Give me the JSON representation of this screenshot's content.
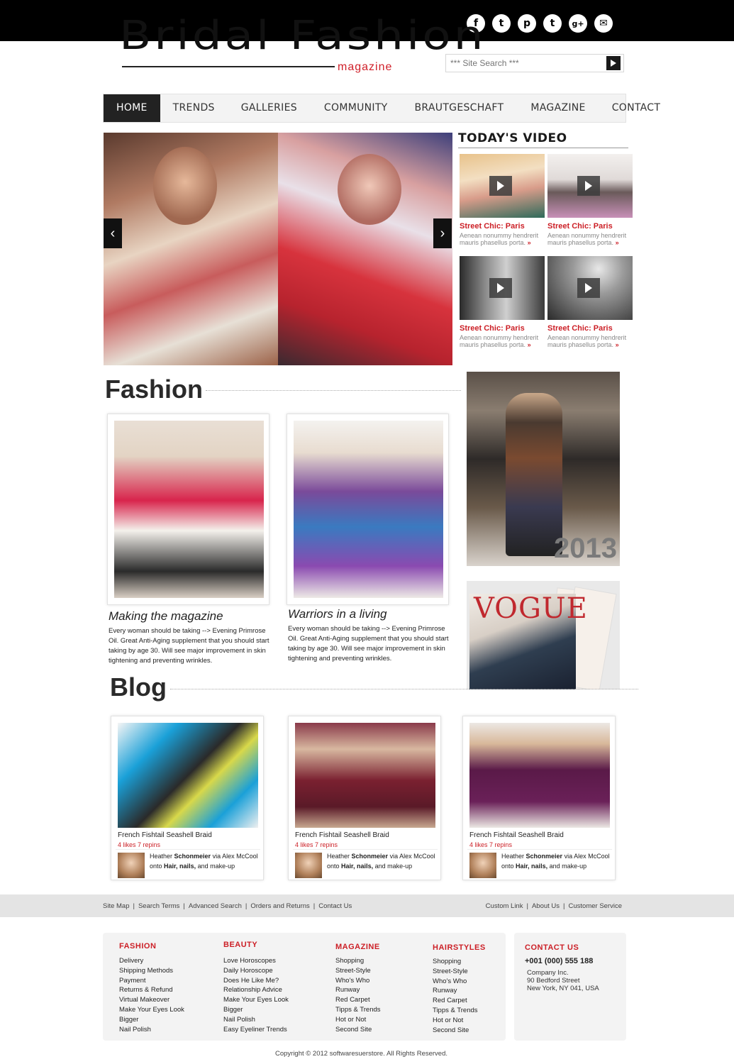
{
  "header": {
    "logo_main": "Bridal Fashion",
    "logo_sub": "magazine",
    "social": [
      {
        "icon": "facebook-icon",
        "glyph": "f"
      },
      {
        "icon": "twitter-icon",
        "glyph": "t"
      },
      {
        "icon": "pinterest-icon",
        "glyph": "p"
      },
      {
        "icon": "tumblr-icon",
        "glyph": "t"
      },
      {
        "icon": "google-plus-icon",
        "glyph": "g+"
      },
      {
        "icon": "email-icon",
        "glyph": "✉"
      }
    ],
    "search_placeholder": "*** Site Search ***"
  },
  "nav": {
    "items": [
      "HOME",
      "TRENDS",
      "GALLERIES",
      "COMMUNITY",
      "BRAUTGESCHAFT",
      "MAGAZINE",
      "CONTACT"
    ],
    "active": "HOME"
  },
  "slider": {
    "prev_glyph": "‹",
    "next_glyph": "›"
  },
  "video": {
    "title": "TODAY'S VIDEO",
    "items": [
      {
        "title": "Street Chic: Paris",
        "desc": "Aenean nonummy hendrerit mauris phasellus porta.",
        "more": "»"
      },
      {
        "title": "Street Chic: Paris",
        "desc": "Aenean nonummy hendrerit mauris phasellus porta.",
        "more": "»"
      },
      {
        "title": "Street Chic: Paris",
        "desc": "Aenean nonummy hendrerit mauris phasellus porta.",
        "more": "»"
      },
      {
        "title": "Street Chic: Paris",
        "desc": "Aenean nonummy hendrerit mauris phasellus porta.",
        "more": "»"
      }
    ]
  },
  "fashion": {
    "heading": "Fashion",
    "cards": [
      {
        "title": "Making the magazine",
        "text": "Every woman should be taking --> Evening Primrose Oil. Great Anti-Aging supplement that you should start taking by age 30. Will see major improvement in skin tightening and preventing wrinkles."
      },
      {
        "title": "Warriors in a living",
        "text": "Every woman should be taking --> Evening Primrose Oil. Great Anti-Aging supplement that you should start taking by age 30. Will see major improvement in skin tightening and preventing wrinkles."
      }
    ],
    "side_year": "2013",
    "magazine_cover": "VOGUE"
  },
  "blog": {
    "heading": "Blog",
    "cards": [
      {
        "title": "French Fishtail Seashell Braid",
        "likes": "4 likes 7 repins",
        "user": "Heather",
        "user_bold": "Schonmeier",
        "via": "via Alex McCool onto",
        "board": "Hair, nails,",
        "board_end": "and make-up"
      },
      {
        "title": "French Fishtail Seashell Braid",
        "likes": "4 likes 7 repins",
        "user": "Heather",
        "user_bold": "Schonmeier",
        "via": "via Alex McCool onto",
        "board": "Hair, nails,",
        "board_end": "and make-up"
      },
      {
        "title": "French Fishtail Seashell Braid",
        "likes": "4 likes 7 repins",
        "user": "Heather",
        "user_bold": "Schonmeier",
        "via": "via Alex McCool onto",
        "board": "Hair, nails,",
        "board_end": "and make-up"
      }
    ]
  },
  "footer_links": {
    "left": [
      "Site Map",
      "Search Terms",
      "Advanced Search",
      "Orders and Returns",
      "Contact Us"
    ],
    "right": [
      "Custom Link",
      "About Us",
      "Customer Service"
    ]
  },
  "footer_columns": [
    {
      "heading": "FASHION",
      "items": [
        "Delivery",
        "Shipping Methods",
        "Payment",
        "Returns & Refund",
        "Virtual Makeover",
        "Make Your Eyes Look",
        "Bigger",
        "Nail Polish"
      ]
    },
    {
      "heading": "BEAUTY",
      "items": [
        "Love Horoscopes",
        "Daily Horoscope",
        "Does He Like Me?",
        "Relationship Advice",
        "Make Your Eyes Look",
        "Bigger",
        "Nail Polish",
        "Easy Eyeliner Trends"
      ]
    },
    {
      "heading": "MAGAZINE",
      "items": [
        "Shopping",
        "Street-Style",
        "Who's Who",
        "Runway",
        "Red Carpet",
        "Tipps & Trends",
        "Hot or Not",
        "Second Site"
      ]
    },
    {
      "heading": "HAIRSTYLES",
      "items": [
        "Shopping",
        "Street-Style",
        "Who's Who",
        "Runway",
        "Red Carpet",
        "Tipps & Trends",
        "Hot or Not",
        "Second Site"
      ]
    }
  ],
  "contact": {
    "heading": "CONTACT US",
    "phone": "+001 (000) 555 188",
    "company": "Company Inc.",
    "street": "90 Bedford Street",
    "city": "New York, NY 041, USA"
  },
  "copyright": "Copyright © 2012 softwaresuerstore. All Rights Reserved."
}
